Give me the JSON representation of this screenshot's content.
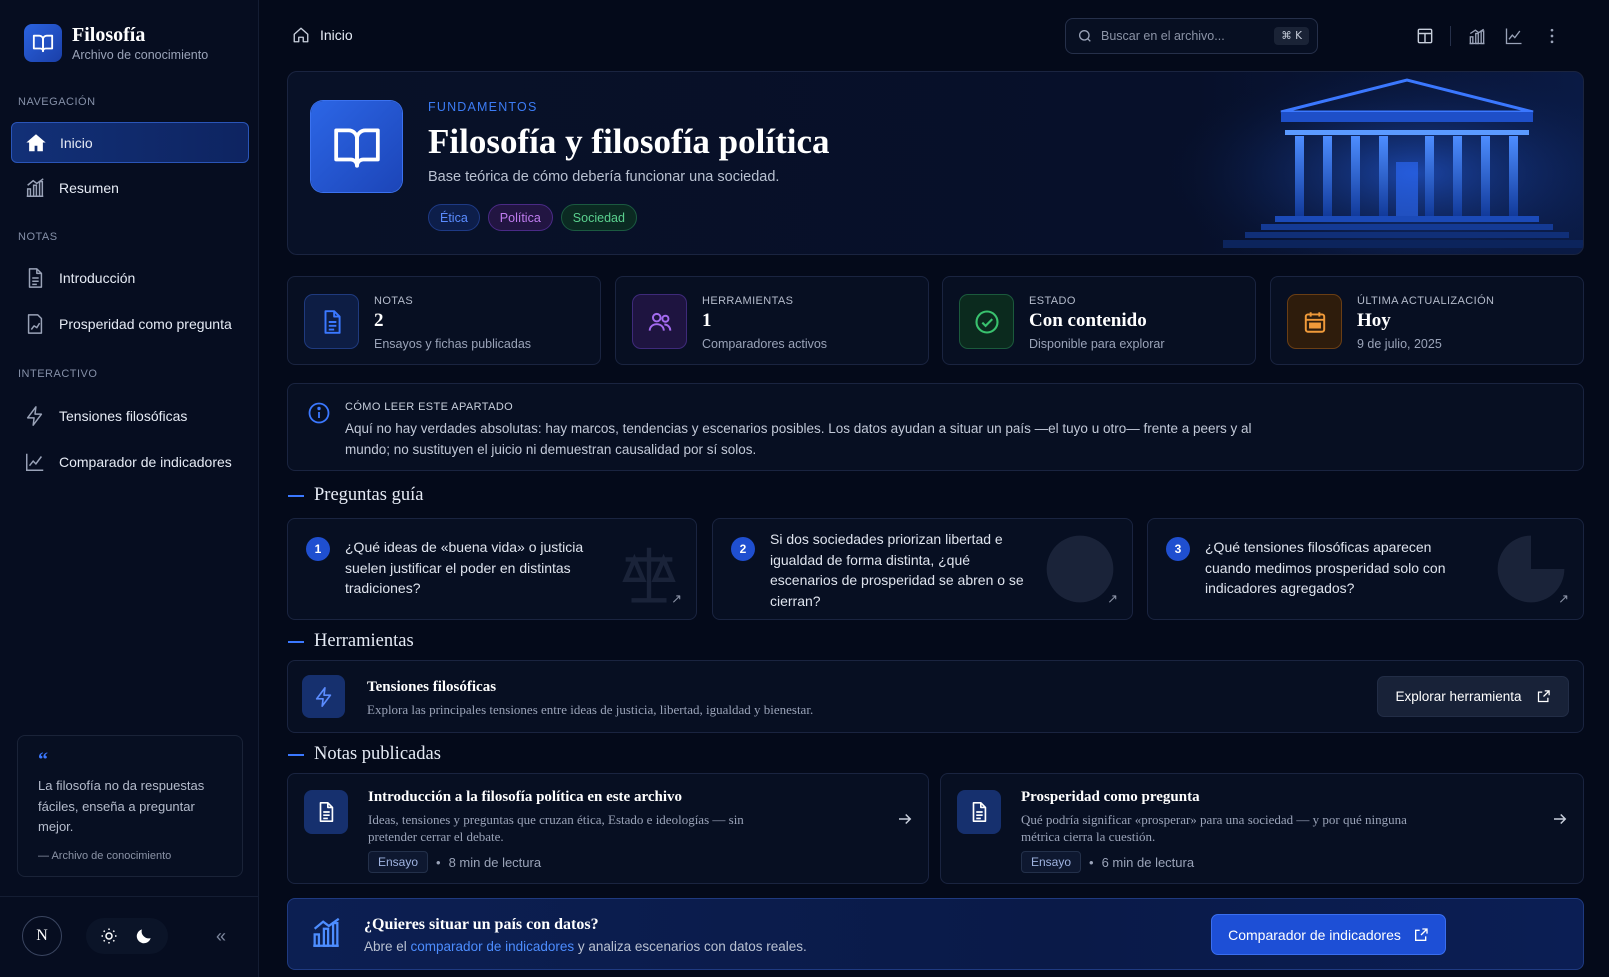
{
  "brand": {
    "title": "Filosofía",
    "subtitle": "Archivo de conocimiento"
  },
  "sidebar": {
    "sections": [
      {
        "label": "NAVEGACIÓN",
        "items": [
          {
            "label": "Inicio",
            "icon": "home-icon",
            "active": true
          },
          {
            "label": "Resumen",
            "icon": "bar-chart-icon",
            "active": false
          }
        ]
      },
      {
        "label": "NOTAS",
        "items": [
          {
            "label": "Introducción",
            "icon": "document-icon",
            "active": false
          },
          {
            "label": "Prosperidad como pregunta",
            "icon": "document-chart-icon",
            "active": false
          }
        ]
      },
      {
        "label": "INTERACTIVO",
        "items": [
          {
            "label": "Tensiones filosóficas",
            "icon": "lightning-icon",
            "active": false
          },
          {
            "label": "Comparador de indicadores",
            "icon": "line-chart-icon",
            "active": false
          }
        ]
      }
    ],
    "quote": {
      "mark": "“",
      "text": "La filosofía no da respuestas fáciles, enseña a preguntar mejor.",
      "source": "— Archivo de conocimiento"
    },
    "avatar_initial": "N",
    "collapse_label": "«"
  },
  "header": {
    "breadcrumb": "Inicio",
    "search_placeholder": "Buscar en el archivo...",
    "search_shortcut": "⌘ K"
  },
  "hero": {
    "kicker": "FUNDAMENTOS",
    "title": "Filosofía y filosofía política",
    "subtitle": "Base teórica de cómo debería funcionar una sociedad.",
    "tags": [
      {
        "label": "Ética",
        "color": "#5b8cff"
      },
      {
        "label": "Política",
        "color": "#c07cf0"
      },
      {
        "label": "Sociedad",
        "color": "#5ad08e"
      }
    ]
  },
  "stats": [
    {
      "label": "NOTAS",
      "value": "2",
      "desc": "Ensayos y fichas publicadas",
      "icon": "document-icon",
      "color": "#3b78ff"
    },
    {
      "label": "HERRAMIENTAS",
      "value": "1",
      "desc": "Comparadores activos",
      "icon": "users-icon",
      "color": "#a46bf0"
    },
    {
      "label": "ESTADO",
      "value": "Con contenido",
      "desc": "Disponible para explorar",
      "icon": "check-circle-icon",
      "color": "#39c26e"
    },
    {
      "label": "ÚLTIMA ACTUALIZACIÓN",
      "value": "Hoy",
      "desc": "9 de julio, 2025",
      "icon": "calendar-icon",
      "color": "#f09a3a"
    }
  ],
  "info": {
    "title": "CÓMO LEER ESTE APARTADO",
    "text": "Aquí no hay verdades absolutas: hay marcos, tendencias y escenarios posibles. Los datos ayudan a situar un país —el tuyo u otro— frente a peers y al mundo; no sustituyen el juicio ni demuestran causalidad por sí solos."
  },
  "questions": {
    "heading": "Preguntas guía",
    "items": [
      {
        "num": "1",
        "text": "¿Qué ideas de «buena vida» o justicia suelen justificar el poder en distintas tradiciones?",
        "deco": "scales-icon"
      },
      {
        "num": "2",
        "text": "Si dos sociedades priorizan libertad e igualdad de forma distinta, ¿qué escenarios de prosperidad se abren o se cierran?",
        "deco": "globe-icon"
      },
      {
        "num": "3",
        "text": "¿Qué tensiones filosóficas aparecen cuando medimos prosperidad solo con indicadores agregados?",
        "deco": "pie-icon"
      }
    ],
    "arrow": "↗"
  },
  "tools": {
    "heading": "Herramientas",
    "items": [
      {
        "title": "Tensiones filosóficas",
        "desc": "Explora las principales tensiones entre ideas de justicia, libertad, igualdad y bienestar.",
        "button": "Explorar herramienta"
      }
    ]
  },
  "notes": {
    "heading": "Notas publicadas",
    "items": [
      {
        "title": "Introducción a la filosofía política en este archivo",
        "desc": "Ideas, tensiones y preguntas que cruzan ética, Estado e ideologías — sin pretender cerrar el debate.",
        "badge": "Ensayo",
        "dot": "•",
        "read": "8 min de lectura"
      },
      {
        "title": "Prosperidad como pregunta",
        "desc": "Qué podría significar «prosperar» para una sociedad — y por qué ninguna métrica cierra la cuestión.",
        "badge": "Ensayo",
        "dot": "•",
        "read": "6 min de lectura"
      }
    ]
  },
  "cta": {
    "title": "¿Quieres situar un país con datos?",
    "text_before": "Abre el ",
    "link": "comparador de indicadores",
    "text_after": " y analiza escenarios con datos reales.",
    "button": "Comparador de indicadores"
  }
}
